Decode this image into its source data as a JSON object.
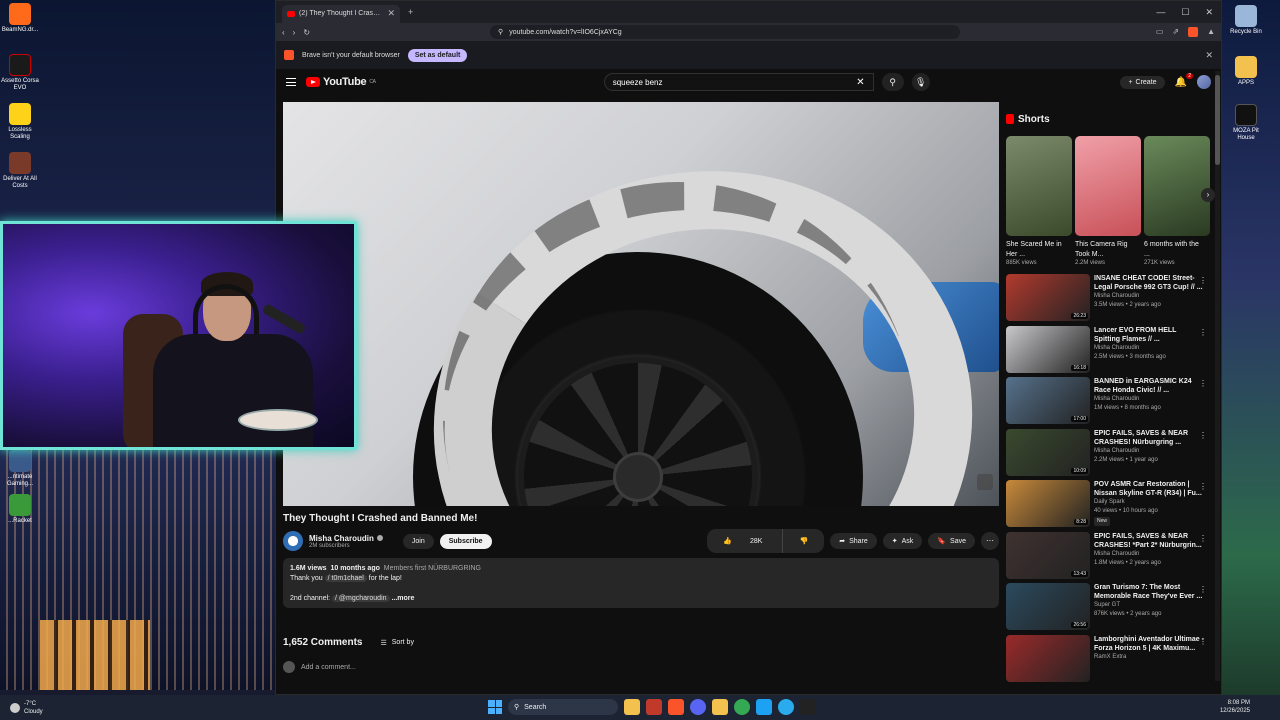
{
  "desktop": {
    "icons": [
      {
        "label": "BeamNG.dr..."
      },
      {
        "label": "Assetto Corsa EVO"
      },
      {
        "label": "Lossless Scaling"
      },
      {
        "label": "Deliver At All Costs"
      },
      {
        "label": "...ntimate Gaming..."
      },
      {
        "label": "...Racket"
      }
    ],
    "right_icons": [
      {
        "label": "Recycle Bin"
      },
      {
        "label": "APPS"
      },
      {
        "label": "MOZA Pit House"
      }
    ]
  },
  "browser": {
    "tab_title": "(2) They Thought I Crashed a...",
    "url": "youtube.com/watch?v=lIO6CjxAYCg",
    "notice_text": "Brave isn't your default browser",
    "notice_button": "Set as default"
  },
  "youtube": {
    "logo": "YouTube",
    "logo_region": "CA",
    "search_value": "squeeze benz",
    "create_label": "Create",
    "notif_count": "2",
    "video": {
      "title": "They Thought I Crashed and Banned Me!",
      "channel": "Misha Charoudin",
      "subscribers": "2M subscribers",
      "join_label": "Join",
      "subscribe_label": "Subscribe",
      "likes": "28K",
      "share_label": "Share",
      "ask_label": "Ask",
      "save_label": "Save",
      "views": "1.6M views",
      "age": "10 months ago",
      "tags": "Members first  NÜRBURGRING",
      "desc_line1_prefix": "Thank you",
      "desc_mention1": "/ t0m1chael",
      "desc_line1_suffix": "for the lap!",
      "desc_line2_prefix": "2nd channel:",
      "desc_mention2": "/ @mgcharoudin",
      "more_label": "...more"
    },
    "comments": {
      "count": "1,652 Comments",
      "sort_label": "Sort by",
      "placeholder": "Add a comment..."
    },
    "shorts": {
      "header": "Shorts",
      "items": [
        {
          "title": "She Scared Me in Her ...",
          "views": "885K views",
          "color": "#4a5a3a"
        },
        {
          "title": "This Camera Rig Took M...",
          "views": "2.2M views",
          "color": "#e07a80"
        },
        {
          "title": "6 months with the ...",
          "views": "271K views",
          "color": "#3e5a34"
        }
      ]
    },
    "recommended": [
      {
        "title": "INSANE CHEAT CODE! Street-Legal Porsche 992 GT3 Cup! // ...",
        "channel": "Misha Charoudin",
        "meta": "3.5M views • 2 years ago",
        "duration": "26:23",
        "color": "#b23a2e"
      },
      {
        "title": "Lancer EVO FROM HELL Spitting Flames // ...",
        "channel": "Misha Charoudin",
        "meta": "2.5M views • 3 months ago",
        "duration": "16:18",
        "color": "#c9c9cc"
      },
      {
        "title": "BANNED in EARGASMIC K24 Race Honda Civic! // ...",
        "channel": "Misha Charoudin",
        "meta": "1M views • 8 months ago",
        "duration": "17:00",
        "color": "#56728c"
      },
      {
        "title": "EPIC FAILS, SAVES & NEAR CRASHES! Nürburgring ...",
        "channel": "Misha Charoudin",
        "meta": "2.2M views • 1 year ago",
        "duration": "10:09",
        "color": "#3a4a2e"
      },
      {
        "title": "POV ASMR Car Restoration | Nissan Skyline GT-R (R34) | Fu...",
        "channel": "Daily Spark",
        "meta": "40 views • 10 hours ago",
        "duration": "8:28",
        "color": "#c88a3a",
        "badge": "New"
      },
      {
        "title": "EPIC FAILS, SAVES & NEAR CRASHES! *Part 2* Nürburgrin...",
        "channel": "Misha Charoudin",
        "meta": "1.8M views • 2 years ago",
        "duration": "13:43",
        "color": "#3f3230"
      },
      {
        "title": "Gran Turismo 7: The Most Memorable Race They've Ever ...",
        "channel": "Super GT",
        "meta": "876K views • 2 years ago",
        "duration": "26:56",
        "color": "#2b4a5e"
      },
      {
        "title": "Lamborghini Aventador Ultimae - Forza Horizon 5 | 4K Maximu...",
        "channel": "RamX Extra",
        "meta": "",
        "duration": "",
        "color": "#9a2a2a"
      }
    ]
  },
  "taskbar": {
    "weather_temp": "-7°C",
    "weather_desc": "Cloudy",
    "search_label": "Search",
    "time": "8:08 PM",
    "date": "12/26/2025"
  }
}
